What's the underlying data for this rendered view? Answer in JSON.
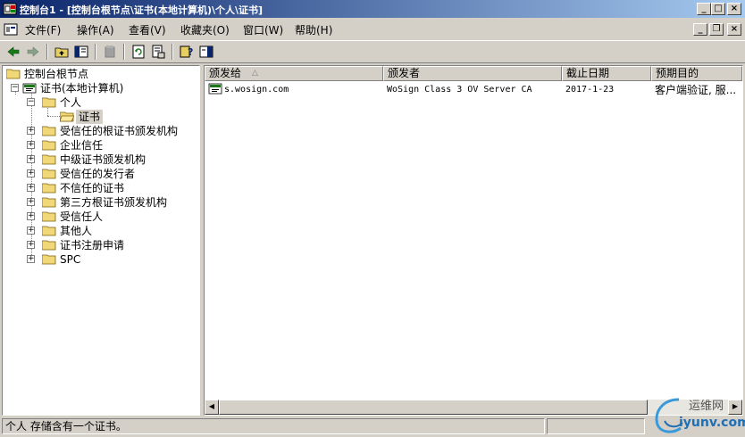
{
  "window": {
    "title": "控制台1 - [控制台根节点\\证书(本地计算机)\\个人\\证书]"
  },
  "title_buttons": {
    "minimize": "_",
    "maximize": "□",
    "close": "×"
  },
  "mdi_buttons": {
    "minimize": "_",
    "restore": "❐",
    "close": "×"
  },
  "menu": {
    "items": [
      {
        "label": "文件(F)"
      },
      {
        "label": "操作(A)"
      },
      {
        "label": "查看(V)"
      },
      {
        "label": "收藏夹(O)"
      },
      {
        "label": "窗口(W)"
      },
      {
        "label": "帮助(H)"
      }
    ]
  },
  "toolbar": {
    "icons": [
      "back-icon",
      "forward-icon",
      "up-folder-icon",
      "show-tree-icon",
      "delete-icon",
      "refresh-icon",
      "export-list-icon",
      "help-icon",
      "action-pane-icon"
    ]
  },
  "tree": {
    "root": "控制台根节点",
    "store": "证书(本地计算机)",
    "personal": "个人",
    "certificates": "证书",
    "items": [
      {
        "label": "受信任的根证书颁发机构"
      },
      {
        "label": "企业信任"
      },
      {
        "label": "中级证书颁发机构"
      },
      {
        "label": "受信任的发行者"
      },
      {
        "label": "不信任的证书"
      },
      {
        "label": "第三方根证书颁发机构"
      },
      {
        "label": "受信任人"
      },
      {
        "label": "其他人"
      },
      {
        "label": "证书注册申请"
      },
      {
        "label": "SPC"
      }
    ]
  },
  "list": {
    "columns": [
      {
        "label": "颁发给"
      },
      {
        "label": "颁发者"
      },
      {
        "label": "截止日期"
      },
      {
        "label": "预期目的"
      }
    ],
    "sort_indicator": "△",
    "rows": [
      {
        "issued_to": "s.wosign.com",
        "issued_by": "WoSign Class 3 OV Server CA",
        "expiration": "2017-1-23",
        "purpose": "客户端验证, 服..."
      }
    ]
  },
  "scroll": {
    "left": "◀",
    "right": "▶"
  },
  "status": {
    "text": "个人 存储含有一个证书。"
  },
  "watermark": {
    "line1": "运维网",
    "line2": "iyunv.com"
  }
}
